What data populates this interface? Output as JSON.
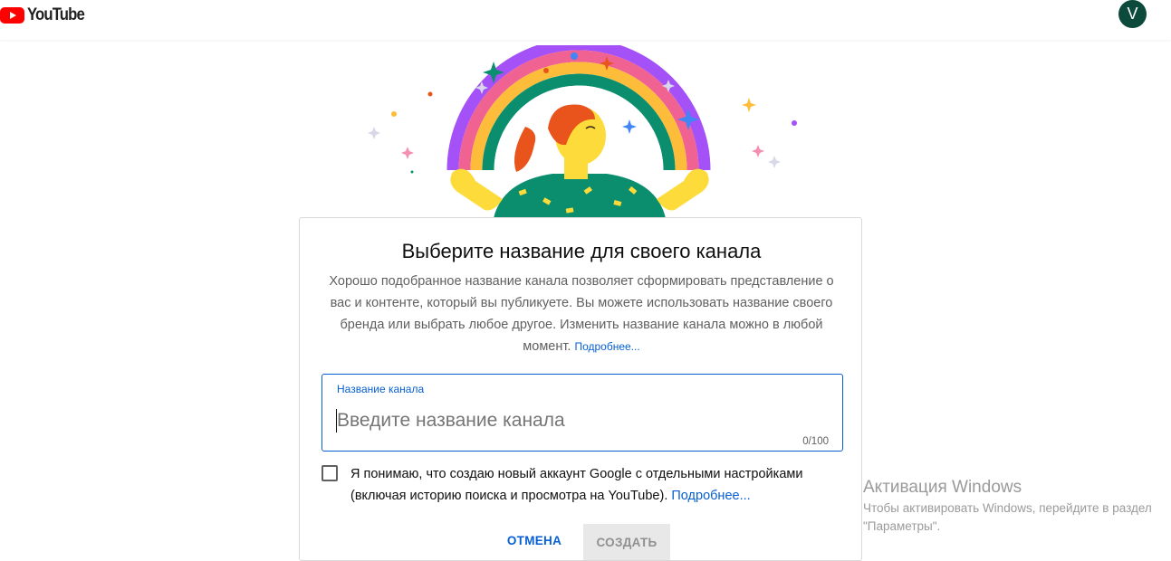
{
  "header": {
    "logo_text": "YouTube",
    "avatar_letter": "V",
    "brand_red": "#ff0000"
  },
  "dialog": {
    "title": "Выберите название для своего канала",
    "description": "Хорошо подобранное название канала позволяет сформировать представление о вас и контенте, который вы публикуете. Вы можете использовать название своего бренда или выбрать любое другое. Изменить название канала можно в любой момент.",
    "description_link": "Подробнее...",
    "field": {
      "label": "Название канала",
      "value": "",
      "placeholder": "Введите название канала",
      "counter": "0/100"
    },
    "checkbox": {
      "checked": false,
      "text": "Я понимаю, что создаю новый аккаунт Google с отдельными настройками (включая историю поиска и просмотра на YouTube).",
      "link": "Подробнее..."
    },
    "buttons": {
      "cancel": "ОТМЕНА",
      "create": "СОЗДАТЬ"
    },
    "accent_color": "#065fd4"
  },
  "watermark": {
    "title": "Активация Windows",
    "subtitle": "Чтобы активировать Windows, перейдите в раздел \"Параметры\"."
  },
  "icons": [
    "youtube-logo-icon",
    "rainbow-illustration",
    "sparkle-icon"
  ]
}
